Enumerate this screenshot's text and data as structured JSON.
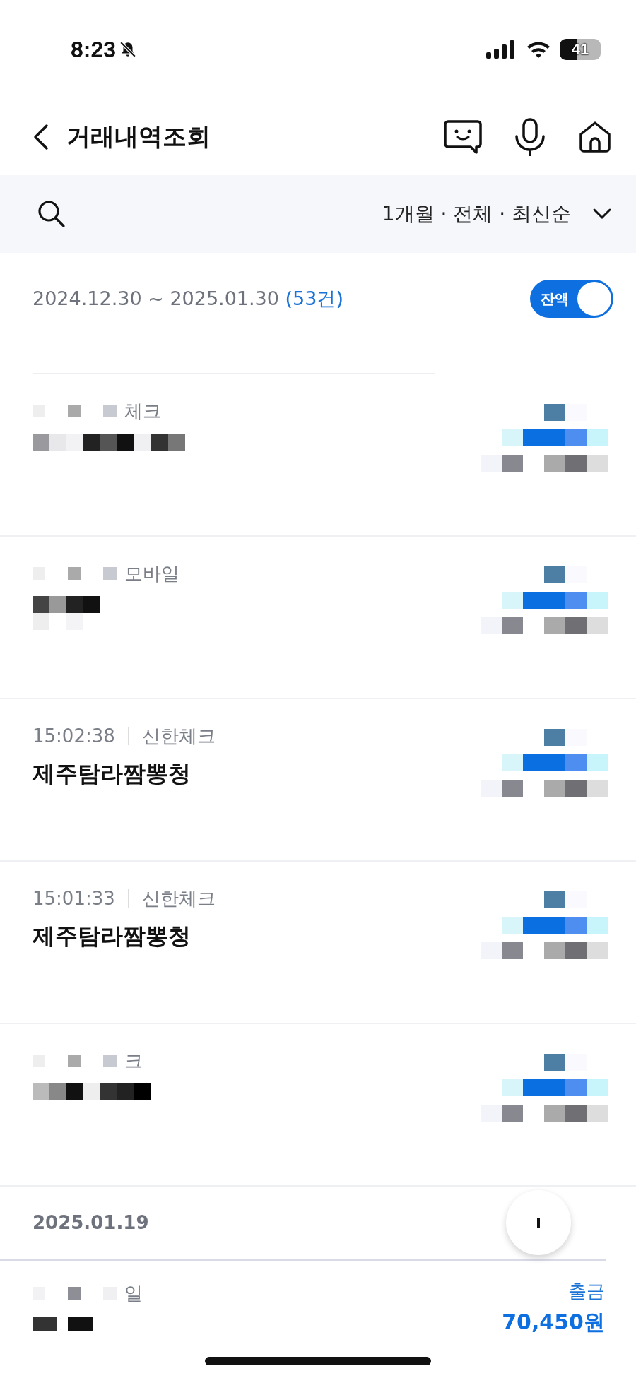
{
  "status_bar": {
    "time": "8:23",
    "battery": "41"
  },
  "header": {
    "title": "거래내역조회"
  },
  "filter": {
    "summary": "1개월 · 전체 · 최신순"
  },
  "range": {
    "dates": "2024.12.30 ~ 2025.01.30",
    "count": "(53건)",
    "balance_toggle": {
      "label": "잔액",
      "on": true
    }
  },
  "transactions": [
    {
      "kind": "masked",
      "meta_fragment": "체크"
    },
    {
      "kind": "masked",
      "meta_fragment": "모바일"
    },
    {
      "kind": "plain",
      "time": "15:02:38",
      "card": "신한체크",
      "merchant": "제주탐라짬뽕청"
    },
    {
      "kind": "plain",
      "time": "15:01:33",
      "card": "신한체크",
      "merchant": "제주탐라짬뽕청"
    },
    {
      "kind": "masked",
      "meta_fragment": "크"
    }
  ],
  "date_group": {
    "date": "2025.01.19",
    "first_row": {
      "meta_fragment": "일",
      "type": "출금",
      "amount": "70,450원"
    }
  }
}
